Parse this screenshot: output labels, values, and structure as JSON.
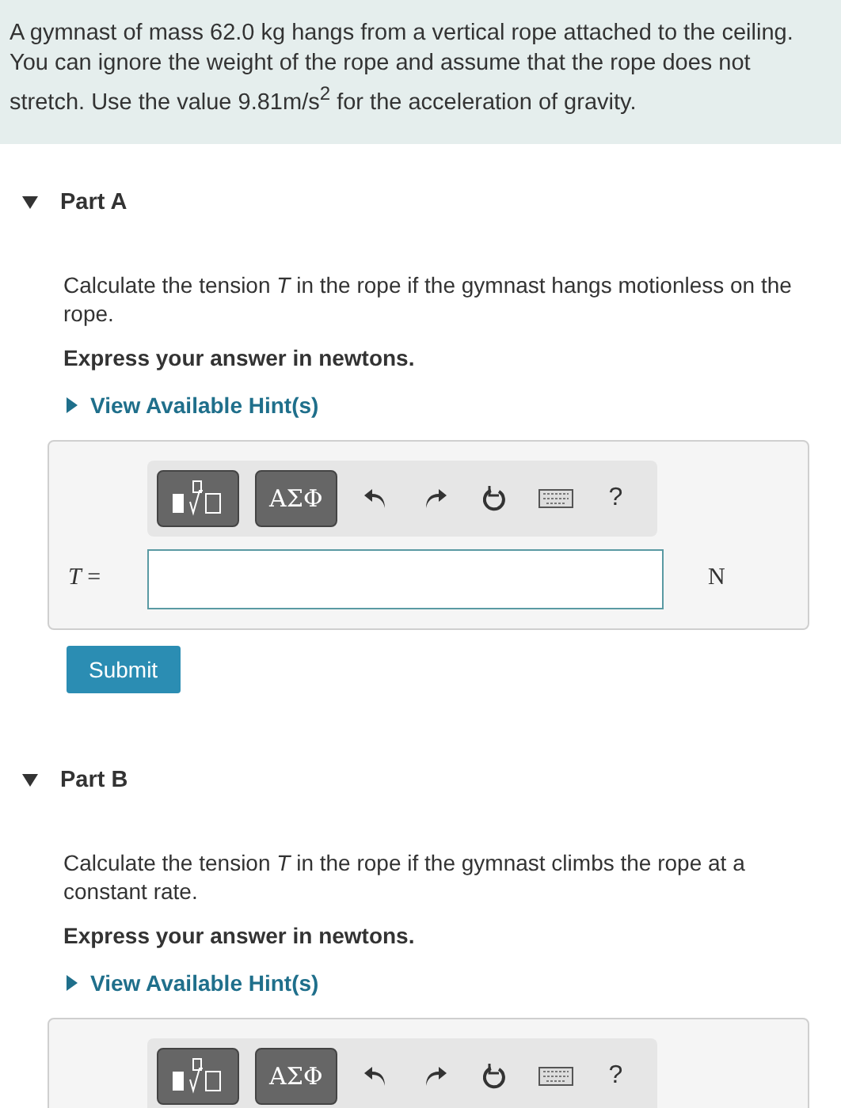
{
  "intro": "A gymnast of mass 62.0 kg hangs from a vertical rope attached to the ceiling. You can ignore the weight of the rope and assume that the rope does not stretch. Use the value 9.81m/s$^{2}$ for the acceleration of gravity.",
  "parts": [
    {
      "label": "Part A",
      "expanded": true,
      "question": "Calculate the tension *T* in the rope if the gymnast hangs motionless on the rope.",
      "instruction": "Express your answer in newtons.",
      "hint": "View Available Hint(s)",
      "toolbar": {
        "greek": "ΑΣΦ",
        "help": "?"
      },
      "answer": {
        "label": "*T* =",
        "unit": "N"
      },
      "submit": "Submit"
    },
    {
      "label": "Part B",
      "expanded": true,
      "question": "Calculate the tension *T* in the rope if the gymnast climbs the rope at a constant rate.",
      "instruction": "Express your answer in newtons.",
      "hint": "View Available Hint(s)",
      "toolbar": {
        "greek": "ΑΣΦ",
        "help": "?"
      }
    }
  ]
}
